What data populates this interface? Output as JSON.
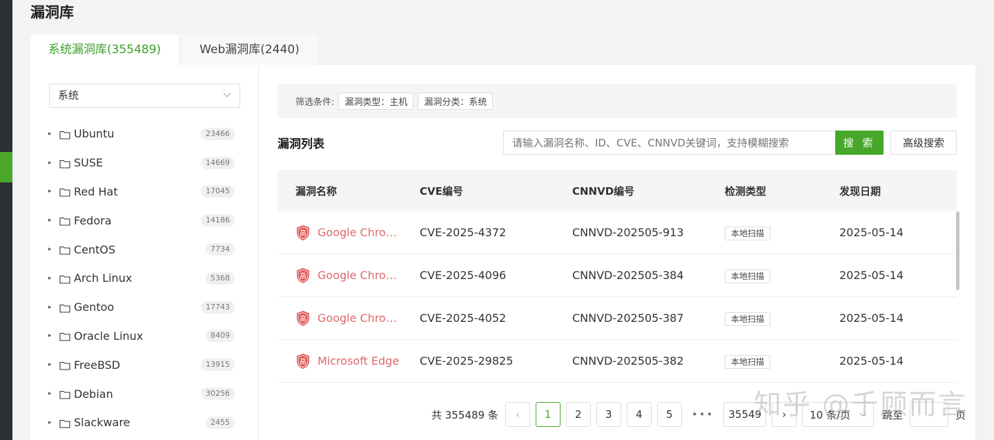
{
  "page_title": "漏洞库",
  "tabs": [
    {
      "label": "系统漏洞库(355489)",
      "active": true
    },
    {
      "label": "Web漏洞库(2440)",
      "active": false
    }
  ],
  "sidebar": {
    "select_value": "系统",
    "tree": [
      {
        "label": "Ubuntu",
        "count": "23466"
      },
      {
        "label": "SUSE",
        "count": "14669"
      },
      {
        "label": "Red Hat",
        "count": "17045"
      },
      {
        "label": "Fedora",
        "count": "14186"
      },
      {
        "label": "CentOS",
        "count": "7734"
      },
      {
        "label": "Arch Linux",
        "count": "5368"
      },
      {
        "label": "Gentoo",
        "count": "17743"
      },
      {
        "label": "Oracle Linux",
        "count": "8409"
      },
      {
        "label": "FreeBSD",
        "count": "13915"
      },
      {
        "label": "Debian",
        "count": "30256"
      },
      {
        "label": "Slackware",
        "count": "2455"
      }
    ]
  },
  "filter": {
    "label": "筛选条件:",
    "tags": [
      "漏洞类型：主机",
      "漏洞分类：系统"
    ]
  },
  "list": {
    "title": "漏洞列表",
    "search_placeholder": "请输入漏洞名称、ID、CVE、CNNVD关键词，支持模糊搜索",
    "search_button": "搜 索",
    "advanced_button": "高级搜索",
    "columns": [
      "漏洞名称",
      "CVE编号",
      "CNNVD编号",
      "检测类型",
      "发现日期"
    ],
    "rows": [
      {
        "severity": "高",
        "name": "Google Chromium",
        "cve": "CVE-2025-4372",
        "cnnvd": "CNNVD-202505-913",
        "type": "本地扫描",
        "date": "2025-05-14"
      },
      {
        "severity": "高",
        "name": "Google Chromium",
        "cve": "CVE-2025-4096",
        "cnnvd": "CNNVD-202505-384",
        "type": "本地扫描",
        "date": "2025-05-14"
      },
      {
        "severity": "高",
        "name": "Google Chromium",
        "cve": "CVE-2025-4052",
        "cnnvd": "CNNVD-202505-387",
        "type": "本地扫描",
        "date": "2025-05-14"
      },
      {
        "severity": "高",
        "name": "Microsoft Edge",
        "cve": "CVE-2025-29825",
        "cnnvd": "CNNVD-202505-382",
        "type": "本地扫描",
        "date": "2025-05-14"
      }
    ]
  },
  "pagination": {
    "total": "共 355489 条",
    "prev": "‹",
    "pages": [
      "1",
      "2",
      "3",
      "4",
      "5"
    ],
    "ellipsis": "•••",
    "last": "35549",
    "next": "›",
    "page_size": "10 条/页",
    "jump_label": "跳至",
    "page_suffix": "页"
  },
  "watermark": "知乎 @千顾而言",
  "colors": {
    "accent": "#47a72b",
    "danger_text": "#e0676a",
    "severity_badge": "#e05a5a"
  },
  "icons": {
    "folder": "folder-icon",
    "caret": "caret-right-icon",
    "severity": "shield-icon",
    "chevron": "chevron-down-icon"
  }
}
